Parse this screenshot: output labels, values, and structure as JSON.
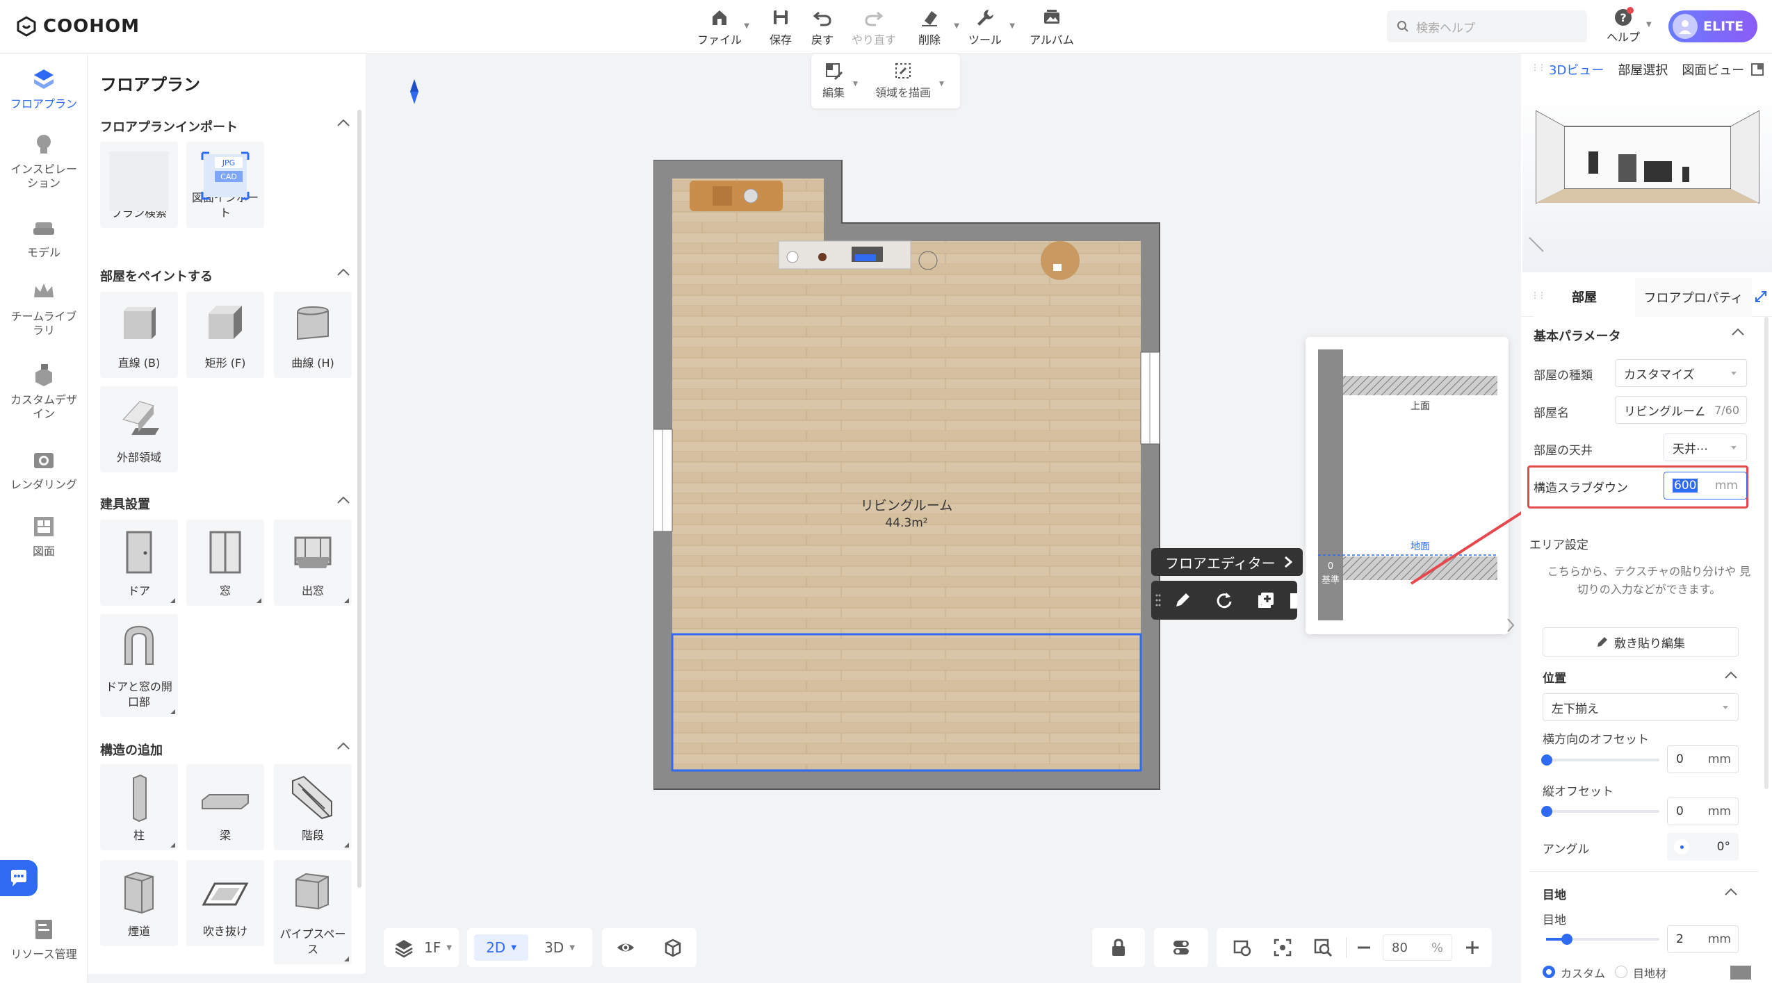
{
  "app": {
    "logo_text": "COOHOM"
  },
  "toolbar": {
    "file": "ファイル",
    "save": "保存",
    "undo": "戻す",
    "redo": "やり直す",
    "delete": "削除",
    "tools": "ツール",
    "album": "アルバム"
  },
  "search": {
    "placeholder": "検索ヘルプ"
  },
  "help": {
    "label": "ヘルプ"
  },
  "account": {
    "badge": "ELITE"
  },
  "leftnav": {
    "items": [
      {
        "label": "フロアプラン",
        "icon": "floorplan-icon"
      },
      {
        "label": "インスピレーション",
        "icon": "lightbulb-icon"
      },
      {
        "label": "モデル",
        "icon": "sofa-icon"
      },
      {
        "label": "チームライブラリ",
        "icon": "crown-icon"
      },
      {
        "label": "カスタムデザイン",
        "icon": "custom-design-icon"
      },
      {
        "label": "レンダリング",
        "icon": "camera-icon"
      },
      {
        "label": "図面",
        "icon": "blueprint-icon"
      },
      {
        "label": "リソース管理",
        "icon": "resource-icon"
      }
    ]
  },
  "leftpanel": {
    "title": "フロアプラン",
    "sections": {
      "import": {
        "title": "フロアプランインポート",
        "cards": [
          "プラン検索",
          "図面インポート"
        ]
      },
      "paint": {
        "title": "部屋をペイントする",
        "cards": [
          "直線 (B)",
          "矩形 (F)",
          "曲線 (H)",
          "外部領域"
        ]
      },
      "fixtures": {
        "title": "建具設置",
        "cards": [
          "ドア",
          "窓",
          "出窓",
          "ドアと窓の開口部"
        ]
      },
      "structure": {
        "title": "構造の追加",
        "cards": [
          "柱",
          "梁",
          "階段",
          "煙道",
          "吹き抜け",
          "パイプスペース"
        ]
      }
    },
    "import_badges": [
      "JPG",
      "CAD"
    ]
  },
  "subtoolbar": {
    "edit": "編集",
    "draw_area": "領域を描画"
  },
  "plan": {
    "room_name": "リビングルーム",
    "room_area": "44.3m²"
  },
  "floor_editor": {
    "label": "フロアエディター"
  },
  "diagram": {
    "top": "上面",
    "ground": "地面",
    "zero": "0",
    "base": "基準"
  },
  "bottombar": {
    "floor": "1F",
    "mode_2d": "2D",
    "mode_3d": "3D",
    "zoom": "80",
    "zoom_unit": "%"
  },
  "rightpanel": {
    "view_tabs": [
      "3Dビュー",
      "部屋選択",
      "図面ビュー"
    ],
    "prop_tabs": [
      "部屋",
      "フロアプロパティ"
    ],
    "basic_params": "基本パラメータ",
    "room_type_label": "部屋の種類",
    "room_type_value": "カスタマイズ",
    "room_name_label": "部屋名",
    "room_name_value": "リビングルー∠",
    "room_name_count": "7/60",
    "ceiling_label": "部屋の天井",
    "ceiling_value": "天井⋯",
    "slab_label": "構造スラブダウン",
    "slab_value": "600",
    "slab_unit": "mm",
    "area_settings": "エリア設定",
    "area_hint": "こちらから、テクスチャの貼り分けや 見切りの入力などができます。",
    "paving_button": "敷き貼り編集",
    "position": "位置",
    "align_value": "左下揃え",
    "h_offset_label": "横方向のオフセット",
    "h_offset_value": "0",
    "h_offset_unit": "mm",
    "v_offset_label": "縦オフセット",
    "v_offset_value": "0",
    "v_offset_unit": "mm",
    "angle_label": "アングル",
    "angle_value": "0°",
    "grout": "目地",
    "grout_label": "目地",
    "grout_value": "2",
    "grout_unit": "mm",
    "radio_custom": "カスタム",
    "radio_material": "目地材"
  },
  "colors": {
    "accent": "#2e6bf2",
    "highlight_red": "#e5484d",
    "wall": "#8a8a8a",
    "floor": "#d8c3a5"
  }
}
